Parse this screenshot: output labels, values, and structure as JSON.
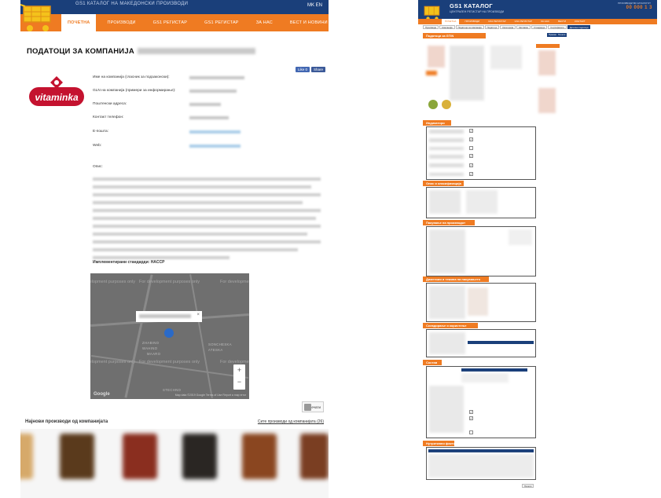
{
  "left": {
    "tagline": "GS1 КАТАЛОГ НА МАКЕДОНСКИ ПРОИЗВОДИ",
    "lang_flags": "MK EN",
    "nav": [
      {
        "label": "ПОЧЕТНА",
        "active": true
      },
      {
        "label": "ПРОИЗВОДИ",
        "active": false
      },
      {
        "label": "GS1 РЕГИСТАР",
        "active": false
      },
      {
        "label": "GS1 РЕГИСТАР",
        "active": false
      },
      {
        "label": "ЗА НАС",
        "active": false
      },
      {
        "label": "ВЕСТ И НОВИНИ",
        "active": false
      }
    ],
    "page_title": "ПОДАТОЦИ ЗА КОМПАНИЈА",
    "share": {
      "like": "Like 0",
      "share": "Share"
    },
    "logo_text": "vitaminka",
    "fields": [
      {
        "label": "Име на компанија (гласник за подзаконски):"
      },
      {
        "label": "GLN на компанија (примери за информирање):"
      },
      {
        "label": "Поштенски адреса:"
      },
      {
        "label": "Контакт телефон:"
      },
      {
        "label": "Е-пошта:"
      },
      {
        "label": "Web:"
      },
      {
        "label": "Опис:"
      }
    ],
    "standards_label": "Имплементирани стандарди: HACCP",
    "map": {
      "watermark": "For development purposes only",
      "district_1": "ZHABINO",
      "district_2": "WAHINO",
      "district_3": "MAARO",
      "district_4": "SONCHESKA",
      "district_5": "STECHNO",
      "district_6": "ATESKA",
      "zoom_in": "+",
      "zoom_out": "−",
      "google": "Google",
      "footer": "Map data ©2019 Google  Terms of Use  Report a map error",
      "close": "×"
    },
    "print_label": "Печати",
    "latest_title": "Најнови производи од компанијата",
    "latest_all": "Сите производи од компанијата (26)",
    "products": [
      {
        "color": "#d6a96a"
      },
      {
        "color": "#5a3a1c"
      },
      {
        "color": "#8a2e1f"
      },
      {
        "color": "#2a2623"
      },
      {
        "color": "#8a4620"
      },
      {
        "color": "#7a3e22"
      }
    ]
  },
  "right": {
    "brand": "GS1 КАТАЛОГ",
    "subtitle": "ЦЕНТРАЛЕН РЕГИСТАР НА ПРОИЗВОДИ",
    "counter_label": "ПРОИЗВОДИ ВО КАТАЛОГОТ",
    "counter": "00 000 1 3",
    "nav": [
      "ПОЧЕТНА",
      "ПРОИЗВОДИ",
      "GS1 РЕГИСТАР",
      "GS1 РЕГИСТАР",
      "ЗА НАС",
      "ВЕСТИ",
      "КОНТАКТ"
    ],
    "crumbs": [
      "Производи",
      "Компанија",
      "Податоци за компанија",
      "Податоци",
      "Категорија",
      "Заглавие",
      "Стандарди",
      "Сертификати",
      "Детални податоци"
    ],
    "sections": {
      "product": "Податоци за GTIN",
      "ingredients": "Индикатори",
      "info": "Опис и класификација",
      "packaging": "Пакување на производот",
      "dims": "Димензии и тежина на пакувањето",
      "storage": "Складирање и користење",
      "nutrition": "Состав",
      "label": "Нутритивни факти"
    },
    "btn_a": "Прикажи",
    "btn_b": "Печати",
    "checks": [
      "✓",
      "✓",
      "",
      "✓",
      "✓",
      "✓"
    ]
  }
}
